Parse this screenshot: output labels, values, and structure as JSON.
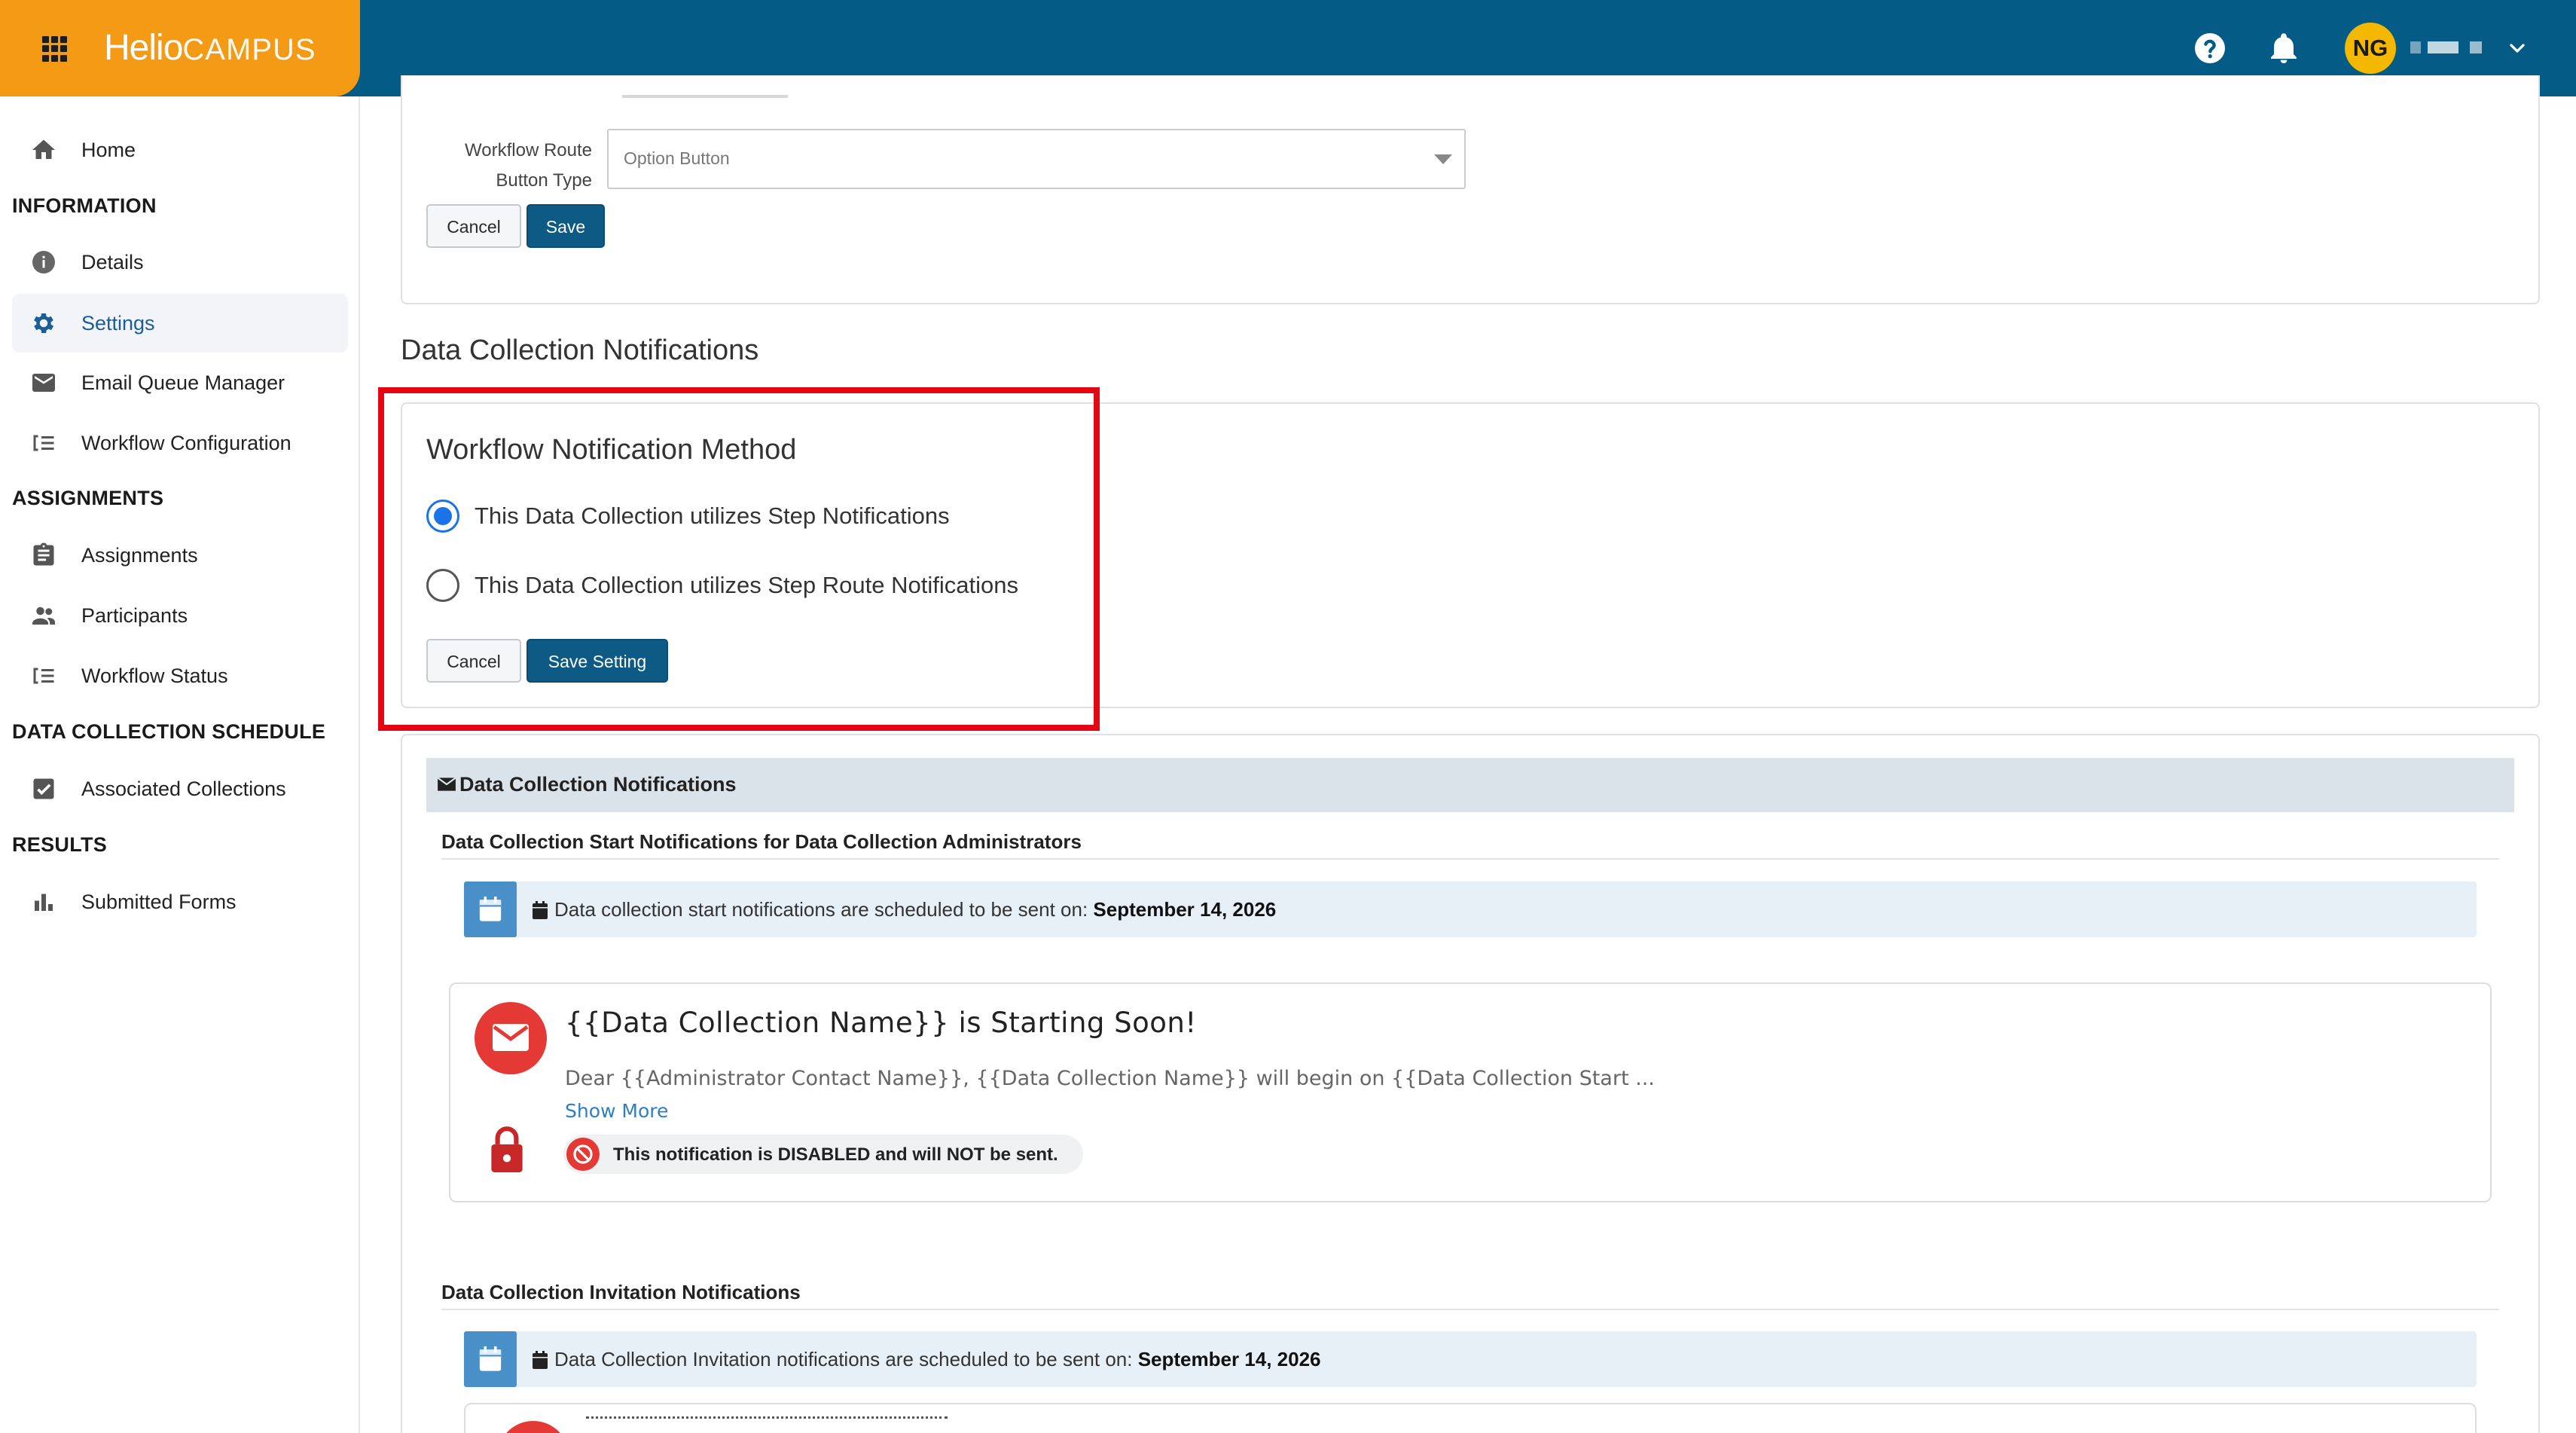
{
  "header": {
    "brand_part1": "Helio",
    "brand_part2": "CAMPUS",
    "user_initials": "NG",
    "icons": [
      "apps-grid-icon",
      "help-icon",
      "bell-icon",
      "chevron-down-icon"
    ]
  },
  "sidebar": {
    "home": "Home",
    "sections": {
      "information": "INFORMATION",
      "assignments": "ASSIGNMENTS",
      "schedule": "DATA COLLECTION SCHEDULE",
      "results": "RESULTS"
    },
    "items": {
      "details": "Details",
      "settings": "Settings",
      "email_queue": "Email Queue Manager",
      "workflow_config": "Workflow Configuration",
      "assignments": "Assignments",
      "participants": "Participants",
      "workflow_status": "Workflow Status",
      "associated_collections": "Associated Collections",
      "submitted_forms": "Submitted Forms"
    },
    "active": "settings"
  },
  "route_form": {
    "label_line1": "Workflow Route",
    "label_line2": "Button Type",
    "select_value": "Option Button",
    "cancel": "Cancel",
    "save": "Save"
  },
  "notifications_section": {
    "title": "Data Collection Notifications",
    "method_card": {
      "title": "Workflow Notification Method",
      "options": [
        {
          "label": "This Data Collection utilizes Step Notifications",
          "checked": true
        },
        {
          "label": "This Data Collection utilizes Step Route Notifications",
          "checked": false
        }
      ],
      "cancel": "Cancel",
      "save": "Save Setting"
    },
    "highlight_color": "#e30613"
  },
  "notifications_list": {
    "band_title": "Data Collection Notifications",
    "start_heading": "Data Collection Start Notifications for Data Collection Administrators",
    "start_info_prefix": "Data collection start notifications are scheduled to be sent on: ",
    "start_info_date": "September 14, 2026",
    "notification": {
      "title": "{{Data Collection Name}} is Starting Soon!",
      "body": "Dear {{Administrator Contact Name}}, {{Data Collection Name}} will begin on {{Data Collection Start ...",
      "show_more": "Show More",
      "status": "This notification is DISABLED and will NOT be sent."
    },
    "invitation_heading": "Data Collection Invitation Notifications",
    "invitation_info_prefix": "Data Collection Invitation notifications are scheduled to be sent on: ",
    "invitation_info_date": "September 14, 2026"
  },
  "colors": {
    "header": "#045b85",
    "brand": "#f59a14",
    "primary_button": "#0d5a85",
    "radio_checked": "#1a73e8",
    "alert_red": "#e53935"
  }
}
